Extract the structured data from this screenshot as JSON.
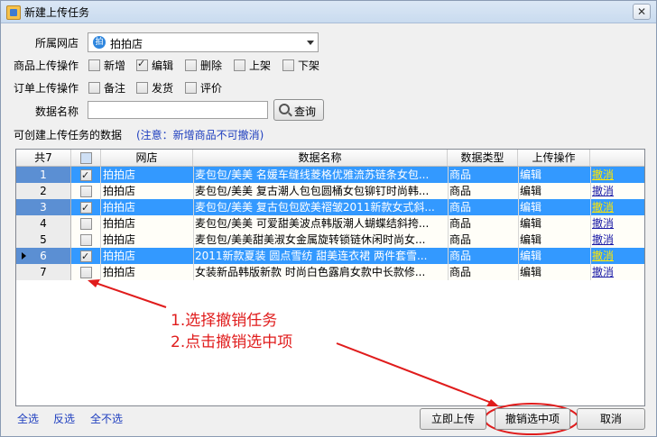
{
  "window": {
    "title": "新建上传任务"
  },
  "form": {
    "shop_label": "所属网店",
    "shop_value": "拍拍店",
    "shop_icon_glyph": "拍",
    "product_ops_label": "商品上传操作",
    "product_ops": [
      {
        "label": "新增",
        "checked": false
      },
      {
        "label": "编辑",
        "checked": true
      },
      {
        "label": "删除",
        "checked": false
      },
      {
        "label": "上架",
        "checked": false
      },
      {
        "label": "下架",
        "checked": false
      }
    ],
    "order_ops_label": "订单上传操作",
    "order_ops": [
      {
        "label": "备注",
        "checked": false
      },
      {
        "label": "发货",
        "checked": false
      },
      {
        "label": "评价",
        "checked": false
      }
    ],
    "data_name_label": "数据名称",
    "data_name_value": "",
    "search_label": "查询",
    "section_title": "可创建上传任务的数据",
    "note": "(注意：新增商品不可撤消)"
  },
  "grid": {
    "headers": {
      "count": "共7",
      "shop": "网店",
      "name": "数据名称",
      "type": "数据类型",
      "op": "上传操作"
    },
    "rows": [
      {
        "num": "1",
        "checked": true,
        "selected": true,
        "shop": "拍拍店",
        "name": "麦包包/美美 名媛车缝线菱格优雅流苏链条女包...",
        "type": "商品",
        "op": "编辑",
        "action": "撤消"
      },
      {
        "num": "2",
        "checked": false,
        "selected": false,
        "shop": "拍拍店",
        "name": "麦包包/美美 复古潮人包包圆桶女包铆钉时尚韩...",
        "type": "商品",
        "op": "编辑",
        "action": "撤消"
      },
      {
        "num": "3",
        "checked": true,
        "selected": true,
        "shop": "拍拍店",
        "name": "麦包包/美美 复古包包欧美褶皱2011新款女式斜...",
        "type": "商品",
        "op": "编辑",
        "action": "撤消"
      },
      {
        "num": "4",
        "checked": false,
        "selected": false,
        "shop": "拍拍店",
        "name": "麦包包/美美 可爱甜美波点韩版潮人蝴蝶结斜挎...",
        "type": "商品",
        "op": "编辑",
        "action": "撤消"
      },
      {
        "num": "5",
        "checked": false,
        "selected": false,
        "shop": "拍拍店",
        "name": "麦包包/美美甜美淑女金属旋转锁链休闲时尚女...",
        "type": "商品",
        "op": "编辑",
        "action": "撤消"
      },
      {
        "num": "6",
        "checked": true,
        "selected": true,
        "shop": "拍拍店",
        "name": "2011新款夏装 圆点雪纺 甜美连衣裙 两件套雪...",
        "type": "商品",
        "op": "编辑",
        "action": "撤消"
      },
      {
        "num": "7",
        "checked": false,
        "selected": false,
        "shop": "拍拍店",
        "name": "女装新品韩版新款 时尚白色露肩女款中长款修...",
        "type": "商品",
        "op": "编辑",
        "action": "撤消"
      }
    ]
  },
  "annotation": {
    "line1": "1.选择撤销任务",
    "line2": "2.点击撤销选中项",
    "color": "#e01c1c"
  },
  "footer": {
    "select_all": "全选",
    "invert": "反选",
    "select_none": "全不选",
    "upload_now": "立即上传",
    "undo_selected": "撤销选中项",
    "cancel": "取消"
  }
}
